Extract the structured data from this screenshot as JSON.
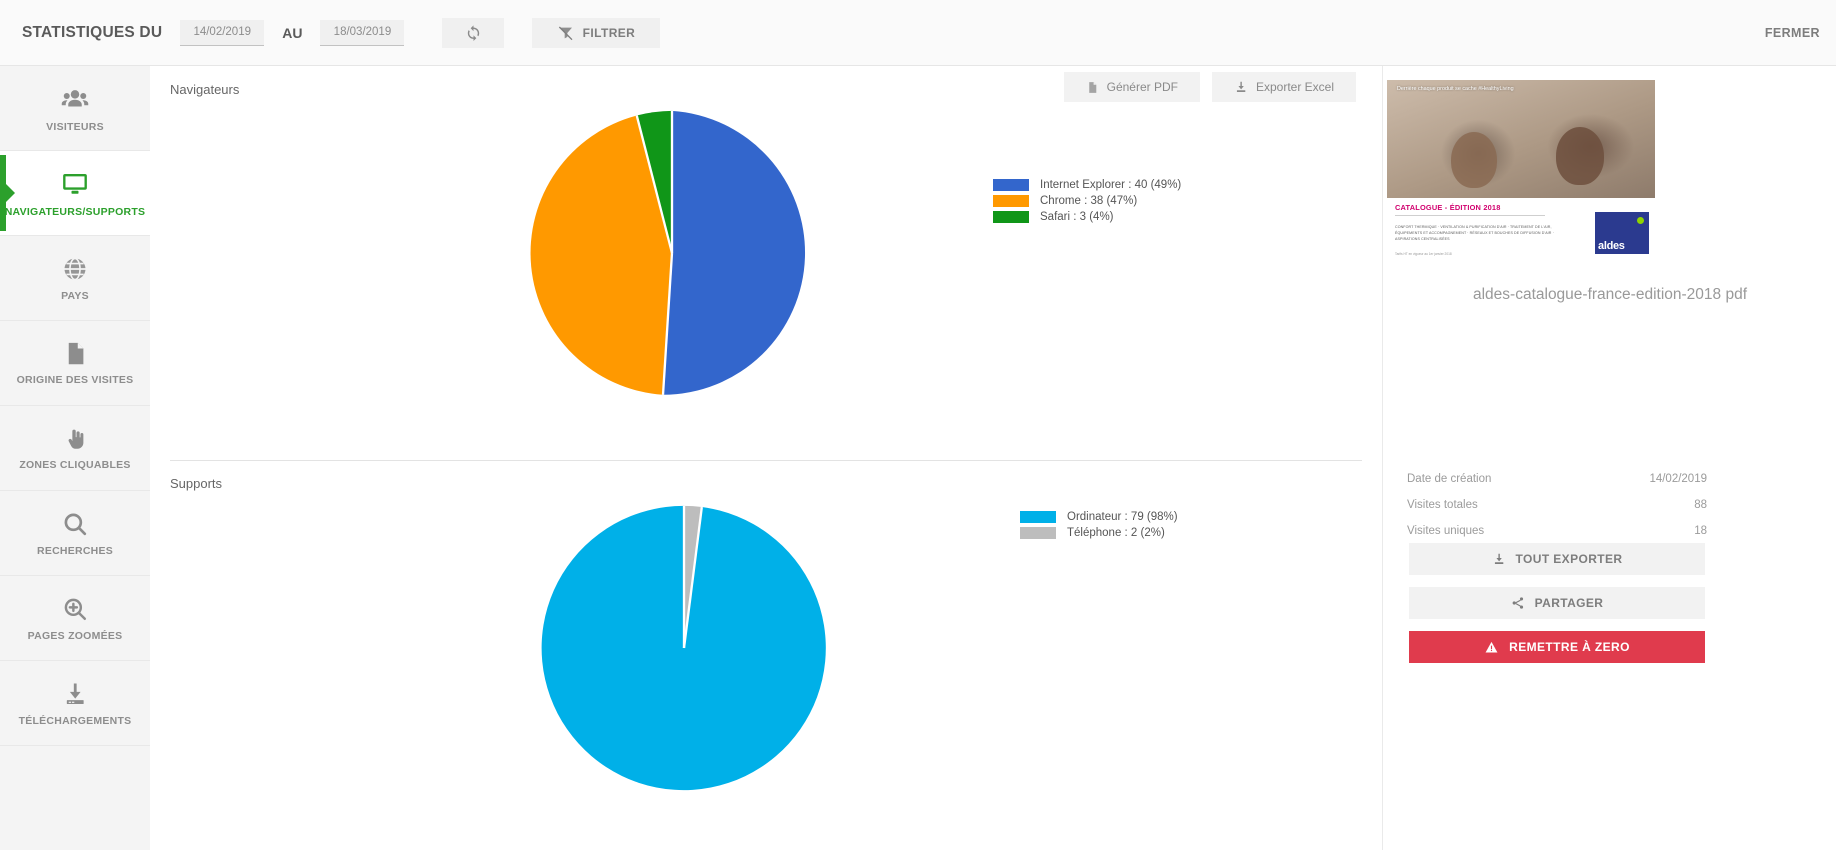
{
  "topbar": {
    "title": "STATISTIQUES DU",
    "date_from": "14/02/2019",
    "date_to": "18/03/2019",
    "au_label": "AU",
    "refresh_icon": "refresh-icon",
    "filter_label": "FILTRER",
    "filter_icon": "filter-off-icon",
    "close_label": "FERMER"
  },
  "sidebar": {
    "items": [
      {
        "label": "VISITEURS",
        "icon": "people-icon",
        "active": false
      },
      {
        "label": "NAVIGATEURS/SUPPORTS",
        "icon": "monitor-icon",
        "active": true
      },
      {
        "label": "PAYS",
        "icon": "globe-icon",
        "active": false
      },
      {
        "label": "ORIGINE DES VISITES",
        "icon": "document-icon",
        "active": false
      },
      {
        "label": "ZONES CLIQUABLES",
        "icon": "pointing-hand-icon",
        "active": false
      },
      {
        "label": "RECHERCHES",
        "icon": "search-icon",
        "active": false
      },
      {
        "label": "PAGES ZOOMÉES",
        "icon": "zoom-in-icon",
        "active": false
      },
      {
        "label": "TÉLÉCHARGEMENTS",
        "icon": "download-icon",
        "active": false
      }
    ],
    "active_color": "#2ca02c",
    "inactive_color": "#8d8d8d"
  },
  "main": {
    "navigateurs_title": "Navigateurs",
    "supports_title": "Supports",
    "generate_pdf_label": "Générer PDF",
    "generate_pdf_icon": "pdf-file-icon",
    "export_excel_label": "Exporter Excel",
    "export_excel_icon": "download-icon"
  },
  "chart_data": [
    {
      "type": "pie",
      "title": "Navigateurs",
      "legend_position": "right",
      "categories": [
        "Internet Explorer",
        "Chrome",
        "Safari"
      ],
      "values": [
        40,
        38,
        3
      ],
      "percents": [
        49,
        47,
        4
      ],
      "colors": [
        "#3366cc",
        "#ff9900",
        "#109618"
      ],
      "legend_labels": [
        "Internet Explorer : 40 (49%)",
        "Chrome : 38 (47%)",
        "Safari : 3 (4%)"
      ]
    },
    {
      "type": "pie",
      "title": "Supports",
      "legend_position": "right",
      "categories": [
        "Ordinateur",
        "Téléphone"
      ],
      "values": [
        79,
        2
      ],
      "percents": [
        98,
        2
      ],
      "colors": [
        "#00b0e8",
        "#bdbdbd"
      ],
      "legend_labels": [
        "Ordinateur : 79 (98%)",
        "Téléphone : 2 (2%)"
      ]
    }
  ],
  "panel": {
    "thumb_tagline": "Derrière chaque produit se cache #HealthyLiving",
    "thumb_catalogue": "CATALOGUE - ",
    "thumb_edition": "ÉDITION 2018",
    "thumb_body": "CONFORT THERMIQUE · VENTILATION & PURIFICATION D'AIR · TRAITEMENT DE L'AIR, ÉQUIPEMENTS ET ACCOMPAGNEMENT · RÉSEAUX ET BOUCHES DE DIFFUSION D'AIR · ASPIRATIONS CENTRALISÉES",
    "thumb_footnote": "Tarifs HT en vigueur au 1er janvier 2018",
    "thumb_logo": "aldes",
    "doc_title": "aldes-catalogue-france-edition-2018 pdf",
    "stats": [
      {
        "label": "Date de création",
        "value": "14/02/2019"
      },
      {
        "label": "Visites totales",
        "value": "88"
      },
      {
        "label": "Visites uniques",
        "value": "18"
      }
    ],
    "export_all_label": "TOUT EXPORTER",
    "export_all_icon": "download-icon",
    "share_label": "PARTAGER",
    "share_icon": "share-icon",
    "reset_label": "REMETTRE À ZERO",
    "reset_icon": "warning-icon",
    "reset_color": "#e03b4d"
  }
}
